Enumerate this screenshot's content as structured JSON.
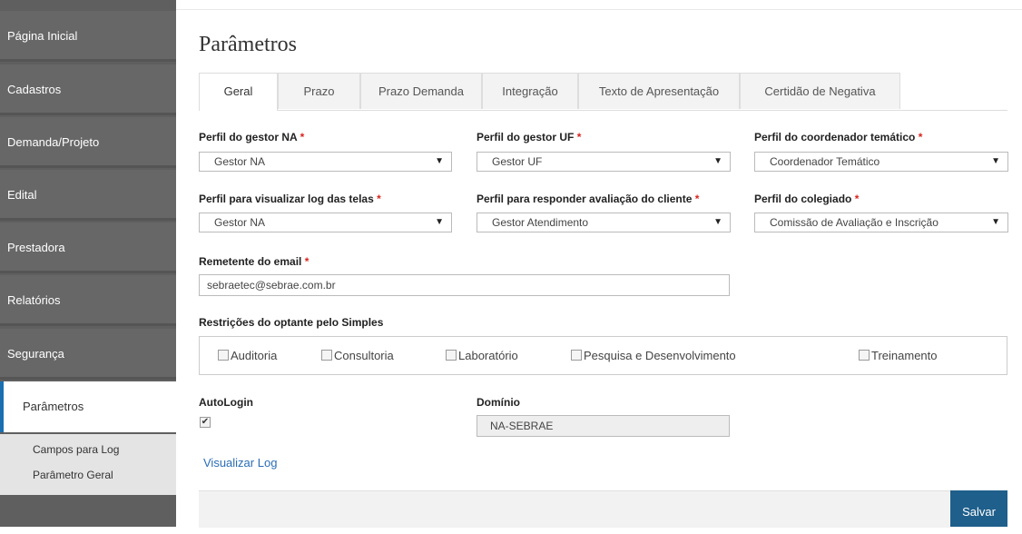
{
  "sidebar": {
    "items": [
      {
        "label": "Página Inicial"
      },
      {
        "label": "Cadastros"
      },
      {
        "label": "Demanda/Projeto"
      },
      {
        "label": "Edital"
      },
      {
        "label": "Prestadora"
      },
      {
        "label": "Relatórios"
      },
      {
        "label": "Segurança"
      },
      {
        "label": "Parâmetros"
      }
    ],
    "subitems": [
      {
        "label": "Campos para Log"
      },
      {
        "label": "Parâmetro Geral"
      }
    ]
  },
  "page": {
    "title": "Parâmetros"
  },
  "tabs": [
    {
      "label": "Geral"
    },
    {
      "label": "Prazo"
    },
    {
      "label": "Prazo Demanda"
    },
    {
      "label": "Integração"
    },
    {
      "label": "Texto de Apresentação"
    },
    {
      "label": "Certidão de Negativa"
    }
  ],
  "form": {
    "gestor_na": {
      "label": "Perfil do gestor NA",
      "value": "Gestor NA"
    },
    "gestor_uf": {
      "label": "Perfil do gestor UF",
      "value": "Gestor UF"
    },
    "coordenador": {
      "label": "Perfil do coordenador temático",
      "value": "Coordenador Temático"
    },
    "log_telas": {
      "label": "Perfil para visualizar log das telas",
      "value": "Gestor NA"
    },
    "avaliacao": {
      "label": "Perfil para responder avaliação do cliente",
      "value": "Gestor Atendimento"
    },
    "colegiado": {
      "label": "Perfil do colegiado",
      "value": "Comissão de Avaliação e Inscrição"
    },
    "remetente": {
      "label": "Remetente do email",
      "value": "sebraetec@sebrae.com.br"
    },
    "required_mark": "*",
    "restricoes": {
      "label": "Restrições do optante pelo Simples",
      "options": [
        {
          "label": "Auditoria",
          "checked": false
        },
        {
          "label": "Consultoria",
          "checked": false
        },
        {
          "label": "Laboratório",
          "checked": false
        },
        {
          "label": "Pesquisa e Desenvolvimento",
          "checked": false
        },
        {
          "label": "Treinamento",
          "checked": false
        }
      ]
    },
    "autologin": {
      "label": "AutoLogin",
      "checked": true,
      "check_glyph": "✔"
    },
    "dominio": {
      "label": "Domínio",
      "value": "NA-SEBRAE"
    },
    "select_arrow": "▼"
  },
  "actions": {
    "view_log": "Visualizar Log",
    "save": "Salvar"
  }
}
